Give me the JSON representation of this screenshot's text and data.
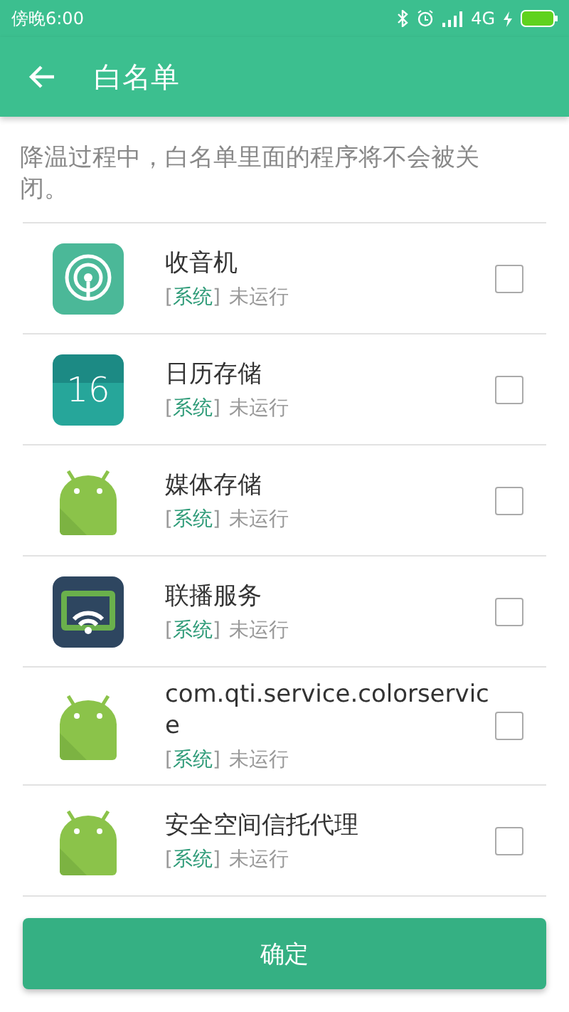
{
  "status_bar": {
    "time": "傍晚6:00",
    "network": "4G"
  },
  "toolbar": {
    "title": "白名单"
  },
  "description": "降温过程中，白名单里面的程序将不会被关闭。",
  "apps": [
    {
      "name": "收音机",
      "kind": "radio",
      "tag": {
        "open": "[",
        "label": "系统",
        "close": "]"
      },
      "status": "未运行",
      "checked": false
    },
    {
      "name": "日历存储",
      "kind": "calendar",
      "icon_text": "16",
      "tag": {
        "open": "[",
        "label": "系统",
        "close": "]"
      },
      "status": "未运行",
      "checked": false
    },
    {
      "name": "媒体存储",
      "kind": "android",
      "tag": {
        "open": "[",
        "label": "系统",
        "close": "]"
      },
      "status": "未运行",
      "checked": false
    },
    {
      "name": "联播服务",
      "kind": "cast",
      "tag": {
        "open": "[",
        "label": "系统",
        "close": "]"
      },
      "status": "未运行",
      "checked": false
    },
    {
      "name": "com.qti.service.colorservice",
      "kind": "android",
      "tag": {
        "open": "[",
        "label": "系统",
        "close": "]"
      },
      "status": "未运行",
      "checked": false
    },
    {
      "name": "安全空间信托代理",
      "kind": "android",
      "tag": {
        "open": "[",
        "label": "系统",
        "close": "]"
      },
      "status": "未运行",
      "checked": false
    }
  ],
  "confirm_button": "确定"
}
